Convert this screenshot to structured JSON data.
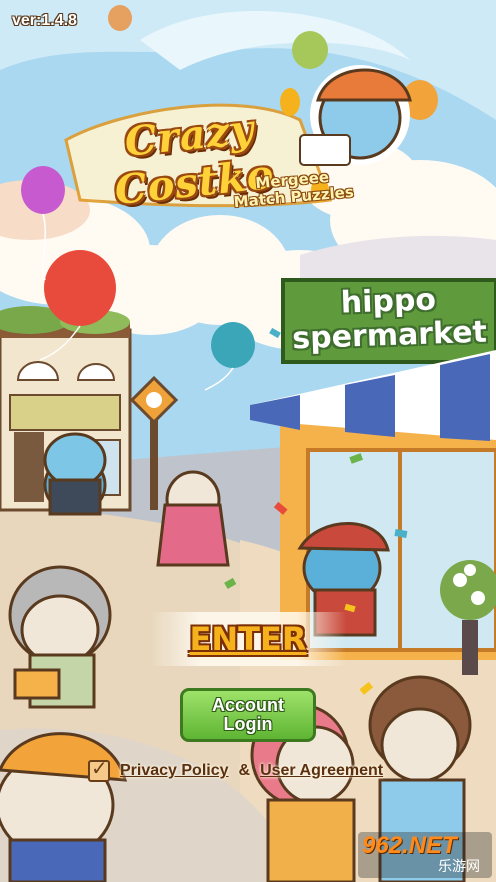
{
  "version": "ver:1.4.8",
  "logo": {
    "title": "Crazy Costko",
    "subtitle_line1": "Mergeee",
    "subtitle_line2": "Match Puzzles"
  },
  "store_sign": {
    "line1": "hippo",
    "line2": "spermarket"
  },
  "buttons": {
    "enter": "ENTER",
    "account_login_line1": "Account",
    "account_login_line2": "Login"
  },
  "agreement": {
    "checked": true,
    "privacy_policy": "Privacy Policy",
    "separator": "&",
    "user_agreement": "User Agreement"
  },
  "watermark": {
    "main": "962.NET",
    "sub": "乐游网"
  },
  "colors": {
    "sky": "#a9d8f0",
    "enter_text": "#f6b21c",
    "login_button": "#6cc23b",
    "sign_green": "#5f9a3c",
    "awning_blue": "#4a68b8"
  }
}
